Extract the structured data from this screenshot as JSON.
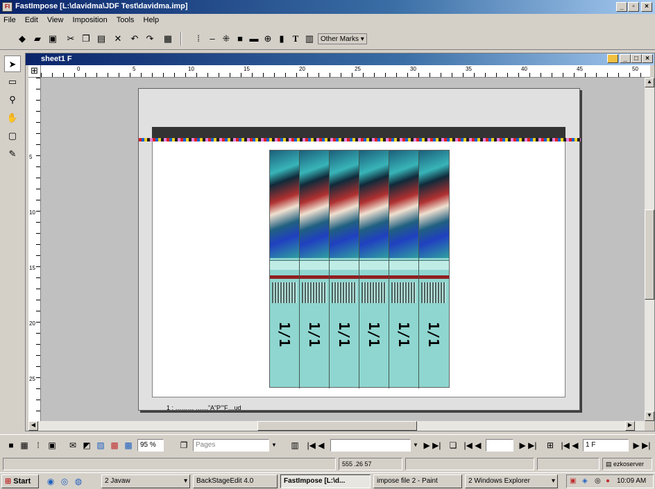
{
  "window": {
    "title": "FastImpose [L:\\davidma\\JDF Test\\davidma.imp]",
    "app_icon": "FI"
  },
  "menu": {
    "items": [
      "File",
      "Edit",
      "View",
      "Imposition",
      "Tools",
      "Help"
    ]
  },
  "toolbar": {
    "other_marks_label": "Other Marks ▾",
    "text_tool_label": "T"
  },
  "document": {
    "title": "sheet1 F"
  },
  "ruler": {
    "h_labels": [
      "0",
      "5",
      "10",
      "15",
      "20",
      "25",
      "30",
      "35",
      "40",
      "45",
      "50"
    ],
    "v_labels": [
      "5",
      "10",
      "15",
      "20",
      "25"
    ]
  },
  "sheet": {
    "slug_text": "1 : ……… ……”A”P’”F…ud",
    "page_numbers": [
      "1/1",
      "1/1",
      "1/1",
      "1/1",
      "1/1",
      "1/1"
    ]
  },
  "navbar": {
    "zoom_value": "95 %",
    "view_select": "Pages",
    "page_field": "",
    "surface_field": "",
    "sheet_field": "1 F"
  },
  "statusbar": {
    "coords": "555 .26 57",
    "server_label": "ezkoserver"
  },
  "taskbar": {
    "start_label": "Start",
    "tasks": [
      {
        "label": "2 Javaw",
        "active": false
      },
      {
        "label": "BackStageEdit 4.0",
        "active": false
      },
      {
        "label": "FastImpose [L:\\d...",
        "active": true
      },
      {
        "label": "impose file 2 - Paint",
        "active": false
      },
      {
        "label": "2 Windows Explorer",
        "active": false
      }
    ],
    "clock": "10:09 AM"
  }
}
